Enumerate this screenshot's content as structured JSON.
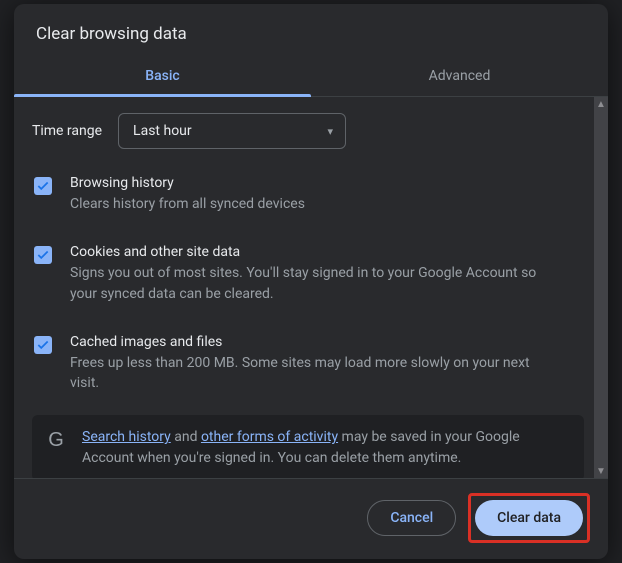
{
  "title": "Clear browsing data",
  "tabs": {
    "basic": "Basic",
    "advanced": "Advanced"
  },
  "timeRange": {
    "label": "Time range",
    "value": "Last hour"
  },
  "options": [
    {
      "title": "Browsing history",
      "desc": "Clears history from all synced devices",
      "checked": true
    },
    {
      "title": "Cookies and other site data",
      "desc": "Signs you out of most sites. You'll stay signed in to your Google Account so your synced data can be cleared.",
      "checked": true
    },
    {
      "title": "Cached images and files",
      "desc": "Frees up less than 200 MB. Some sites may load more slowly on your next visit.",
      "checked": true
    }
  ],
  "notice": {
    "link1": "Search history",
    "mid1": " and ",
    "link2": "other forms of activity",
    "tail": " may be saved in your Google Account when you're signed in. You can delete them anytime."
  },
  "footer": {
    "cancel": "Cancel",
    "clear": "Clear data"
  }
}
